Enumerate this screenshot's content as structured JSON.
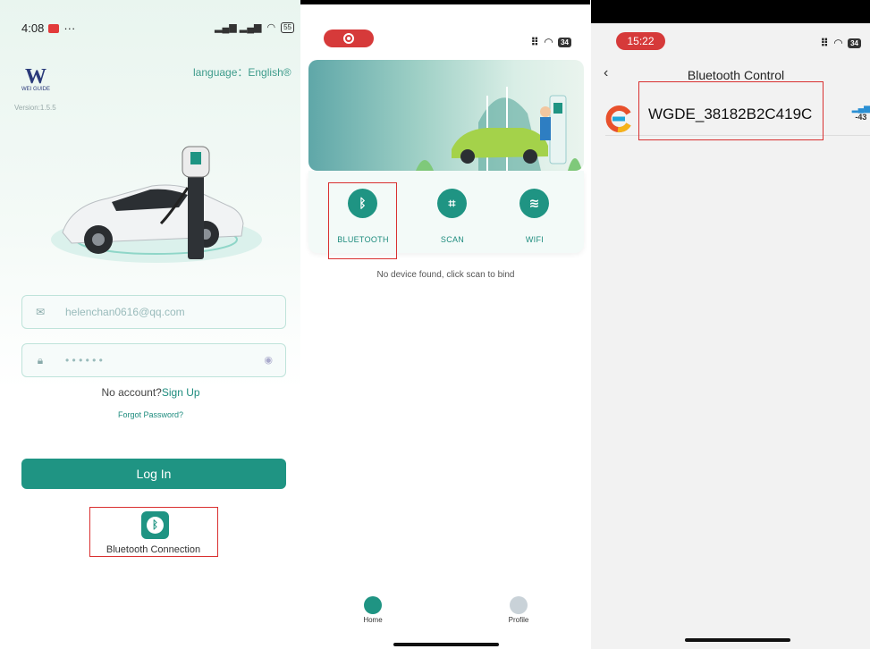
{
  "login_screen": {
    "status_time": "4:08",
    "status_dots": "···",
    "battery": "55",
    "logo_letter": "W",
    "logo_brand": "WEI GUIDE",
    "version": "Version:1.5.5",
    "language": "language：English®",
    "email_value": "helenchan0616@qq.com",
    "password_value": "• • • • • •",
    "no_account": "No account?",
    "sign_up": "Sign Up",
    "forgot": "Forgot Password?",
    "login": "Log In",
    "bluetooth_connection": "Bluetooth Connection"
  },
  "home_screen": {
    "battery": "34",
    "tiles": [
      {
        "label": "BLUETOOTH",
        "icon": "bluetooth-icon"
      },
      {
        "label": "SCAN",
        "icon": "scan-icon"
      },
      {
        "label": "WIFI",
        "icon": "wifi-icon"
      }
    ],
    "no_device": "No device found, click scan to bind",
    "tab_home": "Home",
    "tab_profile": "Profile"
  },
  "bt_screen": {
    "status_time": "15:22",
    "battery": "34",
    "title": "Bluetooth Control",
    "device_name": "WGDE_38182B2C419C",
    "signal": "-43"
  },
  "colors": {
    "accent": "#1f9483",
    "highlight_box": "#d93030",
    "record_pill": "#d63a3a"
  }
}
